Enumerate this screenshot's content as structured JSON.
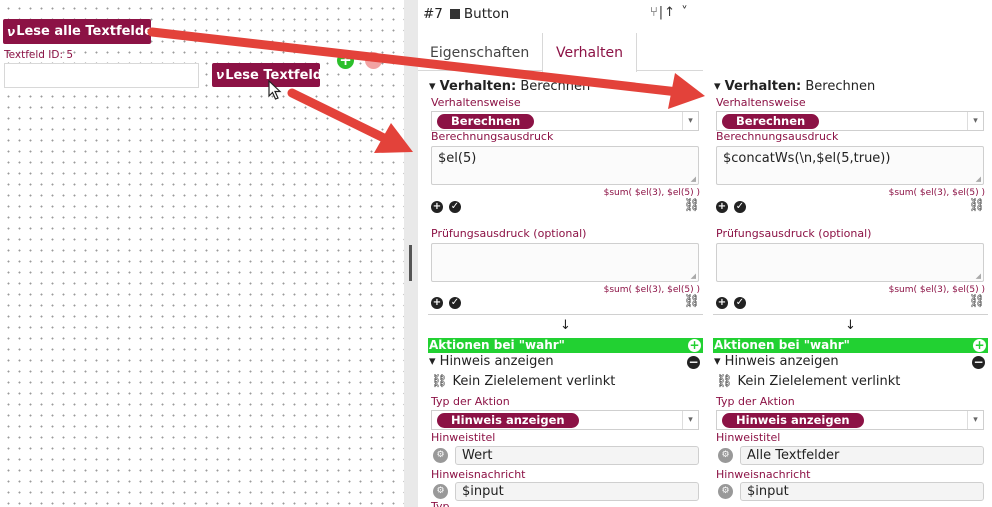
{
  "canvas": {
    "button_read_all": "Lese alle Textfelder",
    "button_read_field": "Lese Textfeld",
    "field_id_label": "Textfeld ID: 5",
    "add_symbol": "+",
    "remove_symbol": "−",
    "bolt_glyph": "ν"
  },
  "header": {
    "title_id": "#7",
    "title_type": "Button",
    "tools": "⑂|↑ ˅"
  },
  "tabs": {
    "properties": "Eigenschaften",
    "behavior": "Verhalten"
  },
  "panels": [
    {
      "section_prefix": "Verhalten:",
      "section_value": "Berechnen",
      "behavior_label": "Verhaltensweise",
      "behavior_value": "Berechnen",
      "expr_label": "Berechnungsausdruck",
      "expr_value": "$el(5)",
      "expr_hint": "$sum( $el(3), $el(5) )",
      "check_label": "Prüfungsausdruck (optional)",
      "check_value": "",
      "check_hint": "$sum( $el(3), $el(5) )",
      "actions_bar": "Aktionen bei \"wahr\"",
      "action_title": "Hinweis anzeigen",
      "no_target": "Kein Zielelement verlinkt",
      "action_type_label": "Typ der Aktion",
      "action_type_value": "Hinweis anzeigen",
      "hint_title_label": "Hinweistitel",
      "hint_title_value": "Wert",
      "hint_msg_label": "Hinweisnachricht",
      "hint_msg_value": "$input",
      "cut_label": "Typ"
    },
    {
      "section_prefix": "Verhalten:",
      "section_value": "Berechnen",
      "behavior_label": "Verhaltensweise",
      "behavior_value": "Berechnen",
      "expr_label": "Berechnungsausdruck",
      "expr_value": "$concatWs(\\n,$el(5,true))",
      "expr_hint": "$sum( $el(3), $el(5) )",
      "check_label": "Prüfungsausdruck (optional)",
      "check_value": "",
      "check_hint": "$sum( $el(3), $el(5) )",
      "actions_bar": "Aktionen bei \"wahr\"",
      "action_title": "Hinweis anzeigen",
      "no_target": "Kein Zielelement verlinkt",
      "action_type_label": "Typ der Aktion",
      "action_type_value": "Hinweis anzeigen",
      "hint_title_label": "Hinweistitel",
      "hint_title_value": "Alle Textfelder",
      "hint_msg_label": "Hinweisnachricht",
      "hint_msg_value": "$input",
      "cut_label": ""
    }
  ],
  "colors": {
    "brand": "#8c1245",
    "green": "#22d132",
    "arrow": "#e3423a",
    "add": "#2bbf2b",
    "remove": "#f2a3a3"
  }
}
